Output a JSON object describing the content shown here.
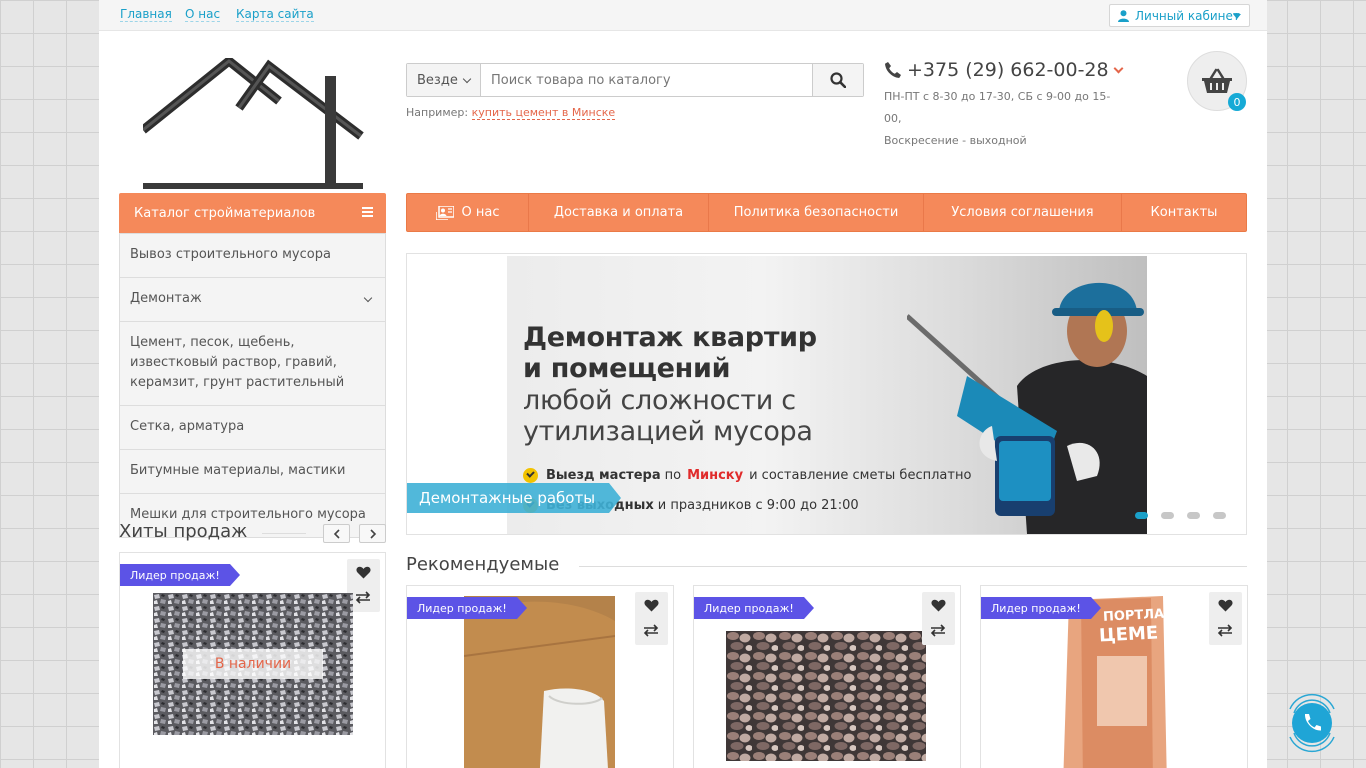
{
  "topbar": {
    "links": [
      "Главная",
      "О нас",
      "Карта сайта"
    ],
    "cabinet_label": "Личный кабинет"
  },
  "search": {
    "scope": "Везде",
    "placeholder": "Поиск товара по каталогу",
    "hint_label": "Например:",
    "hint_link": "купить цемент в Минске"
  },
  "contact": {
    "phone": "+375 (29) 662-00-28",
    "hours_line1": "ПН-ПТ с 8-30 до 17-30, СБ с 9-00 до 15-00,",
    "hours_line2": "Воскресение - выходной"
  },
  "basket": {
    "count": "0"
  },
  "catalog": {
    "title": "Каталог стройматериалов",
    "items": [
      "Вывоз строительного мусора",
      "Демонтаж",
      "Цемент, песок, щебень, известковый раствор, гравий, керамзит, грунт растительный",
      "Сетка, арматура",
      "Битумные материалы, мастики",
      "Мешки для строительного мусора"
    ]
  },
  "nav": {
    "items": [
      "О нас",
      "Доставка и оплата",
      "Политика безопасности",
      "Условия соглашения",
      "Контакты"
    ]
  },
  "banner": {
    "heading_bold_1": "Демонтаж квартир",
    "heading_bold_2": "и помещений",
    "heading_1": "любой сложности с",
    "heading_2": "утилизацией мусора",
    "line1_a": "Выезд мастера",
    "line1_b": "по",
    "line1_city": "Минску",
    "line1_c": "и составление сметы бесплатно",
    "line2_a": "Без выходных",
    "line2_b": "и праздников с 9:00 до 21:00",
    "caption": "Демонтажные работы",
    "slides": 4,
    "active_slide": 1
  },
  "hits": {
    "title": "Хиты продаж",
    "badge": "Лидер продаж!",
    "stock": "В наличии"
  },
  "recommended": {
    "title": "Рекомендуемые",
    "badge": "Лидер продаж!",
    "bag_text_1": "ПОРТЛАН",
    "bag_text_2": "ЦЕМЕ"
  },
  "colors": {
    "accent": "#f5895a",
    "link": "#1aa0c9",
    "badge": "#5c53e6",
    "caption": "#3eb0d6"
  }
}
